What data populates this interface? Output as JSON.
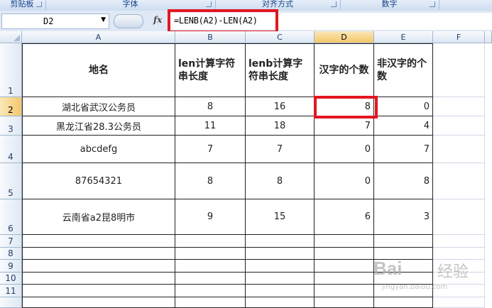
{
  "ribbon": {
    "groups": [
      "剪贴板",
      "字体",
      "对齐方式",
      "数字"
    ]
  },
  "formula_bar": {
    "name_box": "D2",
    "fx_label": "fx",
    "formula": "=LENB(A2)-LEN(A2)"
  },
  "columns": [
    "A",
    "B",
    "C",
    "D",
    "E",
    "F"
  ],
  "rows": [
    "1",
    "2",
    "3",
    "4",
    "5",
    "6",
    "7",
    "8",
    "9",
    "10",
    "11"
  ],
  "headers": {
    "a": "地名",
    "b": "len计算字符串长度",
    "c": "lenb计算字符串长度",
    "d": "汉字的个数",
    "e": "非汉字的个数"
  },
  "table": [
    {
      "a": "湖北省武汉公务员",
      "b": "8",
      "c": "16",
      "d": "8",
      "e": "0"
    },
    {
      "a": "黑龙江省28.3公务员",
      "b": "11",
      "c": "18",
      "d": "7",
      "e": "4"
    },
    {
      "a": "abcdefg",
      "b": "7",
      "c": "7",
      "d": "0",
      "e": "7"
    },
    {
      "a": "87654321",
      "b": "8",
      "c": "8",
      "d": "0",
      "e": "8"
    },
    {
      "a": "云南省a2昆8明市",
      "b": "9",
      "c": "15",
      "d": "6",
      "e": "3"
    }
  ],
  "colors": {
    "highlight": "#e31620",
    "selected_header": "#f5c66b"
  },
  "watermark": {
    "logo": "Bai",
    "text": "经验",
    "url": "jingyan.baidu.com"
  }
}
